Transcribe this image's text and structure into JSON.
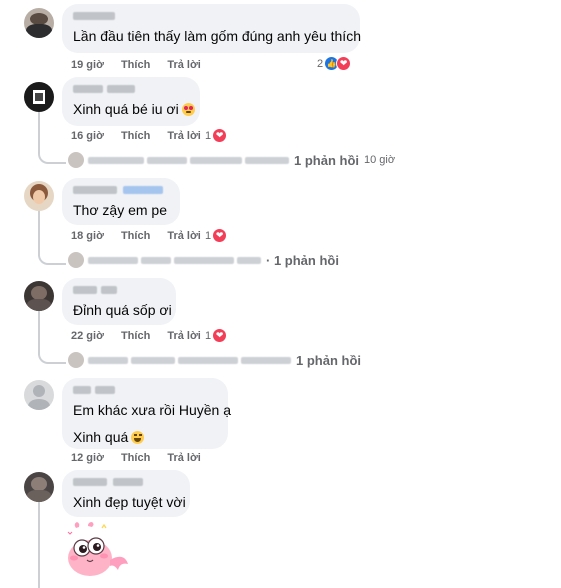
{
  "comments": [
    {
      "text": "Lần đầu tiên thấy làm gốm đúng anh yêu thích",
      "time": "19 giờ",
      "like": "Thích",
      "reply": "Trả lời",
      "react_count": "2"
    },
    {
      "text": "Xinh quá bé iu ơi",
      "time": "16 giờ",
      "like": "Thích",
      "reply": "Trả lời",
      "react_count": "1",
      "reply_summary": "1 phản hồi",
      "reply_time": "10 giờ"
    },
    {
      "text": "Thơ zậy em pe",
      "time": "18 giờ",
      "like": "Thích",
      "reply": "Trả lời",
      "react_count": "1",
      "reply_summary": "· 1 phản hồi"
    },
    {
      "text": "Đỉnh quá sốp ơi",
      "time": "22 giờ",
      "like": "Thích",
      "reply": "Trả lời",
      "react_count": "1",
      "reply_summary": "1 phản hồi"
    },
    {
      "text": "Em khác xưa rồi Huyền ạ",
      "text2": "Xinh quá",
      "time": "12 giờ",
      "like": "Thích",
      "reply": "Trả lời"
    },
    {
      "text": "Xinh đẹp tuyệt vời"
    }
  ],
  "icons": {
    "like": "like-reaction-icon",
    "heart": "heart-reaction-icon",
    "sticker": "pink-pig-sticker"
  },
  "colors": {
    "heart": "#f33e58",
    "like": "#1b74e4",
    "bubble": "#f0f2f5",
    "meta": "#65676b"
  }
}
